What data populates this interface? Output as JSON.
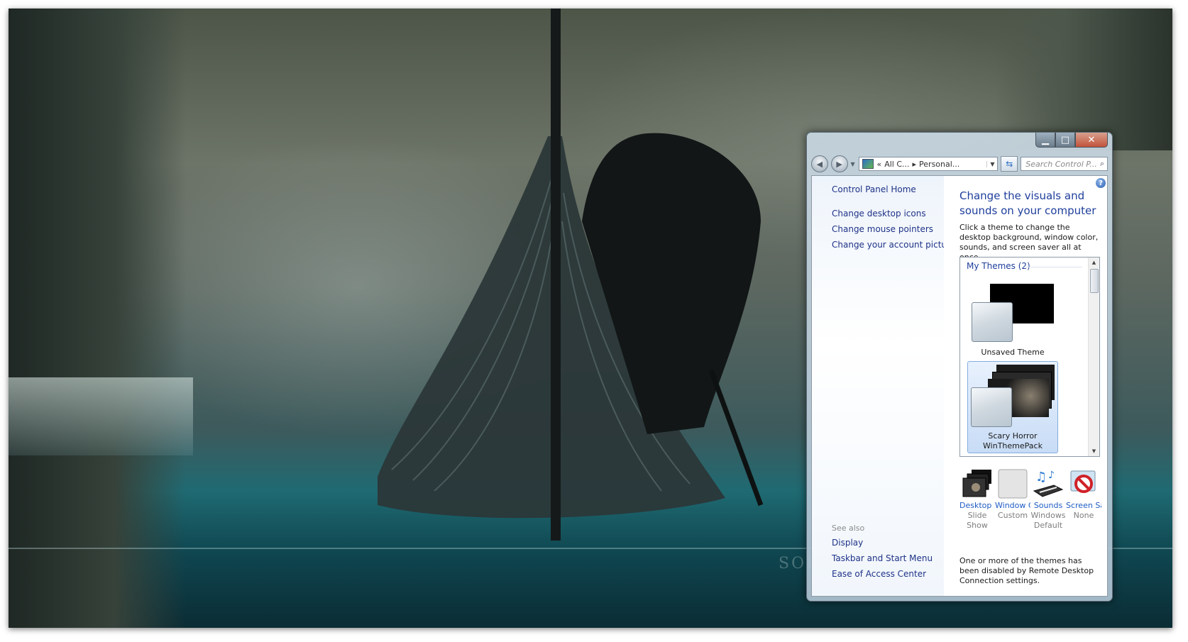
{
  "window": {
    "controls": {
      "minimize": "▁",
      "maximize": "□",
      "close": "✕"
    },
    "address": {
      "prefix": "«",
      "segment1": "All C...",
      "separator": "▸",
      "segment2": "Personal..."
    },
    "search_placeholder": "Search Control P..."
  },
  "sidebar": {
    "home": "Control Panel Home",
    "links": [
      "Change desktop icons",
      "Change mouse pointers",
      "Change your account picture"
    ],
    "see_also_label": "See also",
    "see_also": [
      "Display",
      "Taskbar and Start Menu",
      "Ease of Access Center"
    ]
  },
  "main": {
    "title": "Change the visuals and sounds on your computer",
    "description": "Click a theme to change the desktop background, window color, sounds, and screen saver all at once.",
    "group_label": "My Themes (2)",
    "themes": [
      {
        "name": "Unsaved Theme"
      },
      {
        "name": "Scary Horror WinThemePack",
        "selected": true
      }
    ],
    "options": [
      {
        "label": "Desktop Background",
        "value": "Slide Show",
        "icon": "desktop-background-icon"
      },
      {
        "label": "Window Color",
        "value": "Custom",
        "icon": "window-color-icon"
      },
      {
        "label": "Sounds",
        "value": "Windows Default",
        "icon": "sounds-icon"
      },
      {
        "label": "Screen Saver",
        "value": "None",
        "icon": "screen-saver-icon"
      }
    ],
    "footnote": "One or more of the themes has been disabled by Remote Desktop Connection settings."
  },
  "desktop": {
    "watermark": "SOFTPEDIA"
  },
  "colors": {
    "link": "#1e3287",
    "title": "#1e3e9c",
    "selection": "#c8dcf6"
  }
}
